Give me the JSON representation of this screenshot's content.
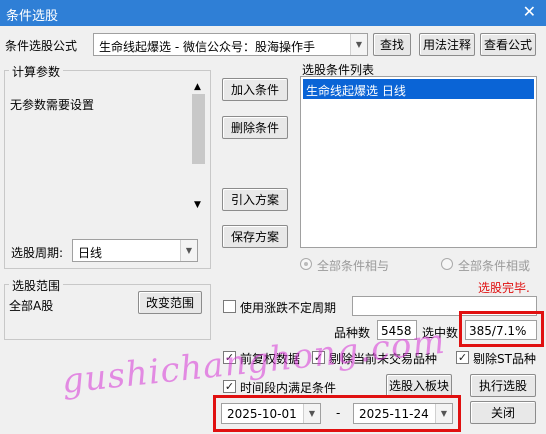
{
  "window": {
    "title": "条件选股",
    "close_glyph": "✕"
  },
  "formula": {
    "label": "条件选股公式",
    "value": "生命线起爆选  -  微信公众号：股海操作手",
    "find": "查找",
    "usage": "用法注释",
    "view": "查看公式"
  },
  "params": {
    "title": "计算参数",
    "text": "无参数需要设置",
    "period_label": "选股周期:",
    "period_value": "日线"
  },
  "actions": {
    "add": "加入条件",
    "delete": "删除条件",
    "import": "引入方案",
    "save": "保存方案"
  },
  "conditions": {
    "title": "选股条件列表",
    "items": [
      "生命线起爆选  日线"
    ],
    "and_label": "全部条件相与",
    "or_label": "全部条件相或"
  },
  "status": {
    "done": "选股完毕.",
    "count_label": "品种数",
    "count_value": "5458",
    "selected_label": "选中数",
    "selected_value": "385/7.1%"
  },
  "range": {
    "title": "选股范围",
    "value": "全部A股",
    "change": "改变范围"
  },
  "options": {
    "use_period": "使用涨跌不定周期",
    "fq": "前复权数据",
    "exclude_suspended": "剔除当前未交易品种",
    "exclude_st": "剔除ST品种",
    "time_cond": "时间段内满足条件"
  },
  "bottom": {
    "to_block": "选股入板块",
    "execute": "执行选股",
    "close": "关闭",
    "date_from": "2025-10-01",
    "date_to": "2025-11-24",
    "dash": "-"
  },
  "watermark": "gushichanghong.com",
  "colors": {
    "titlebar": "#2f7fd6",
    "highlight": "#0a64d6",
    "red": "#e01010"
  }
}
